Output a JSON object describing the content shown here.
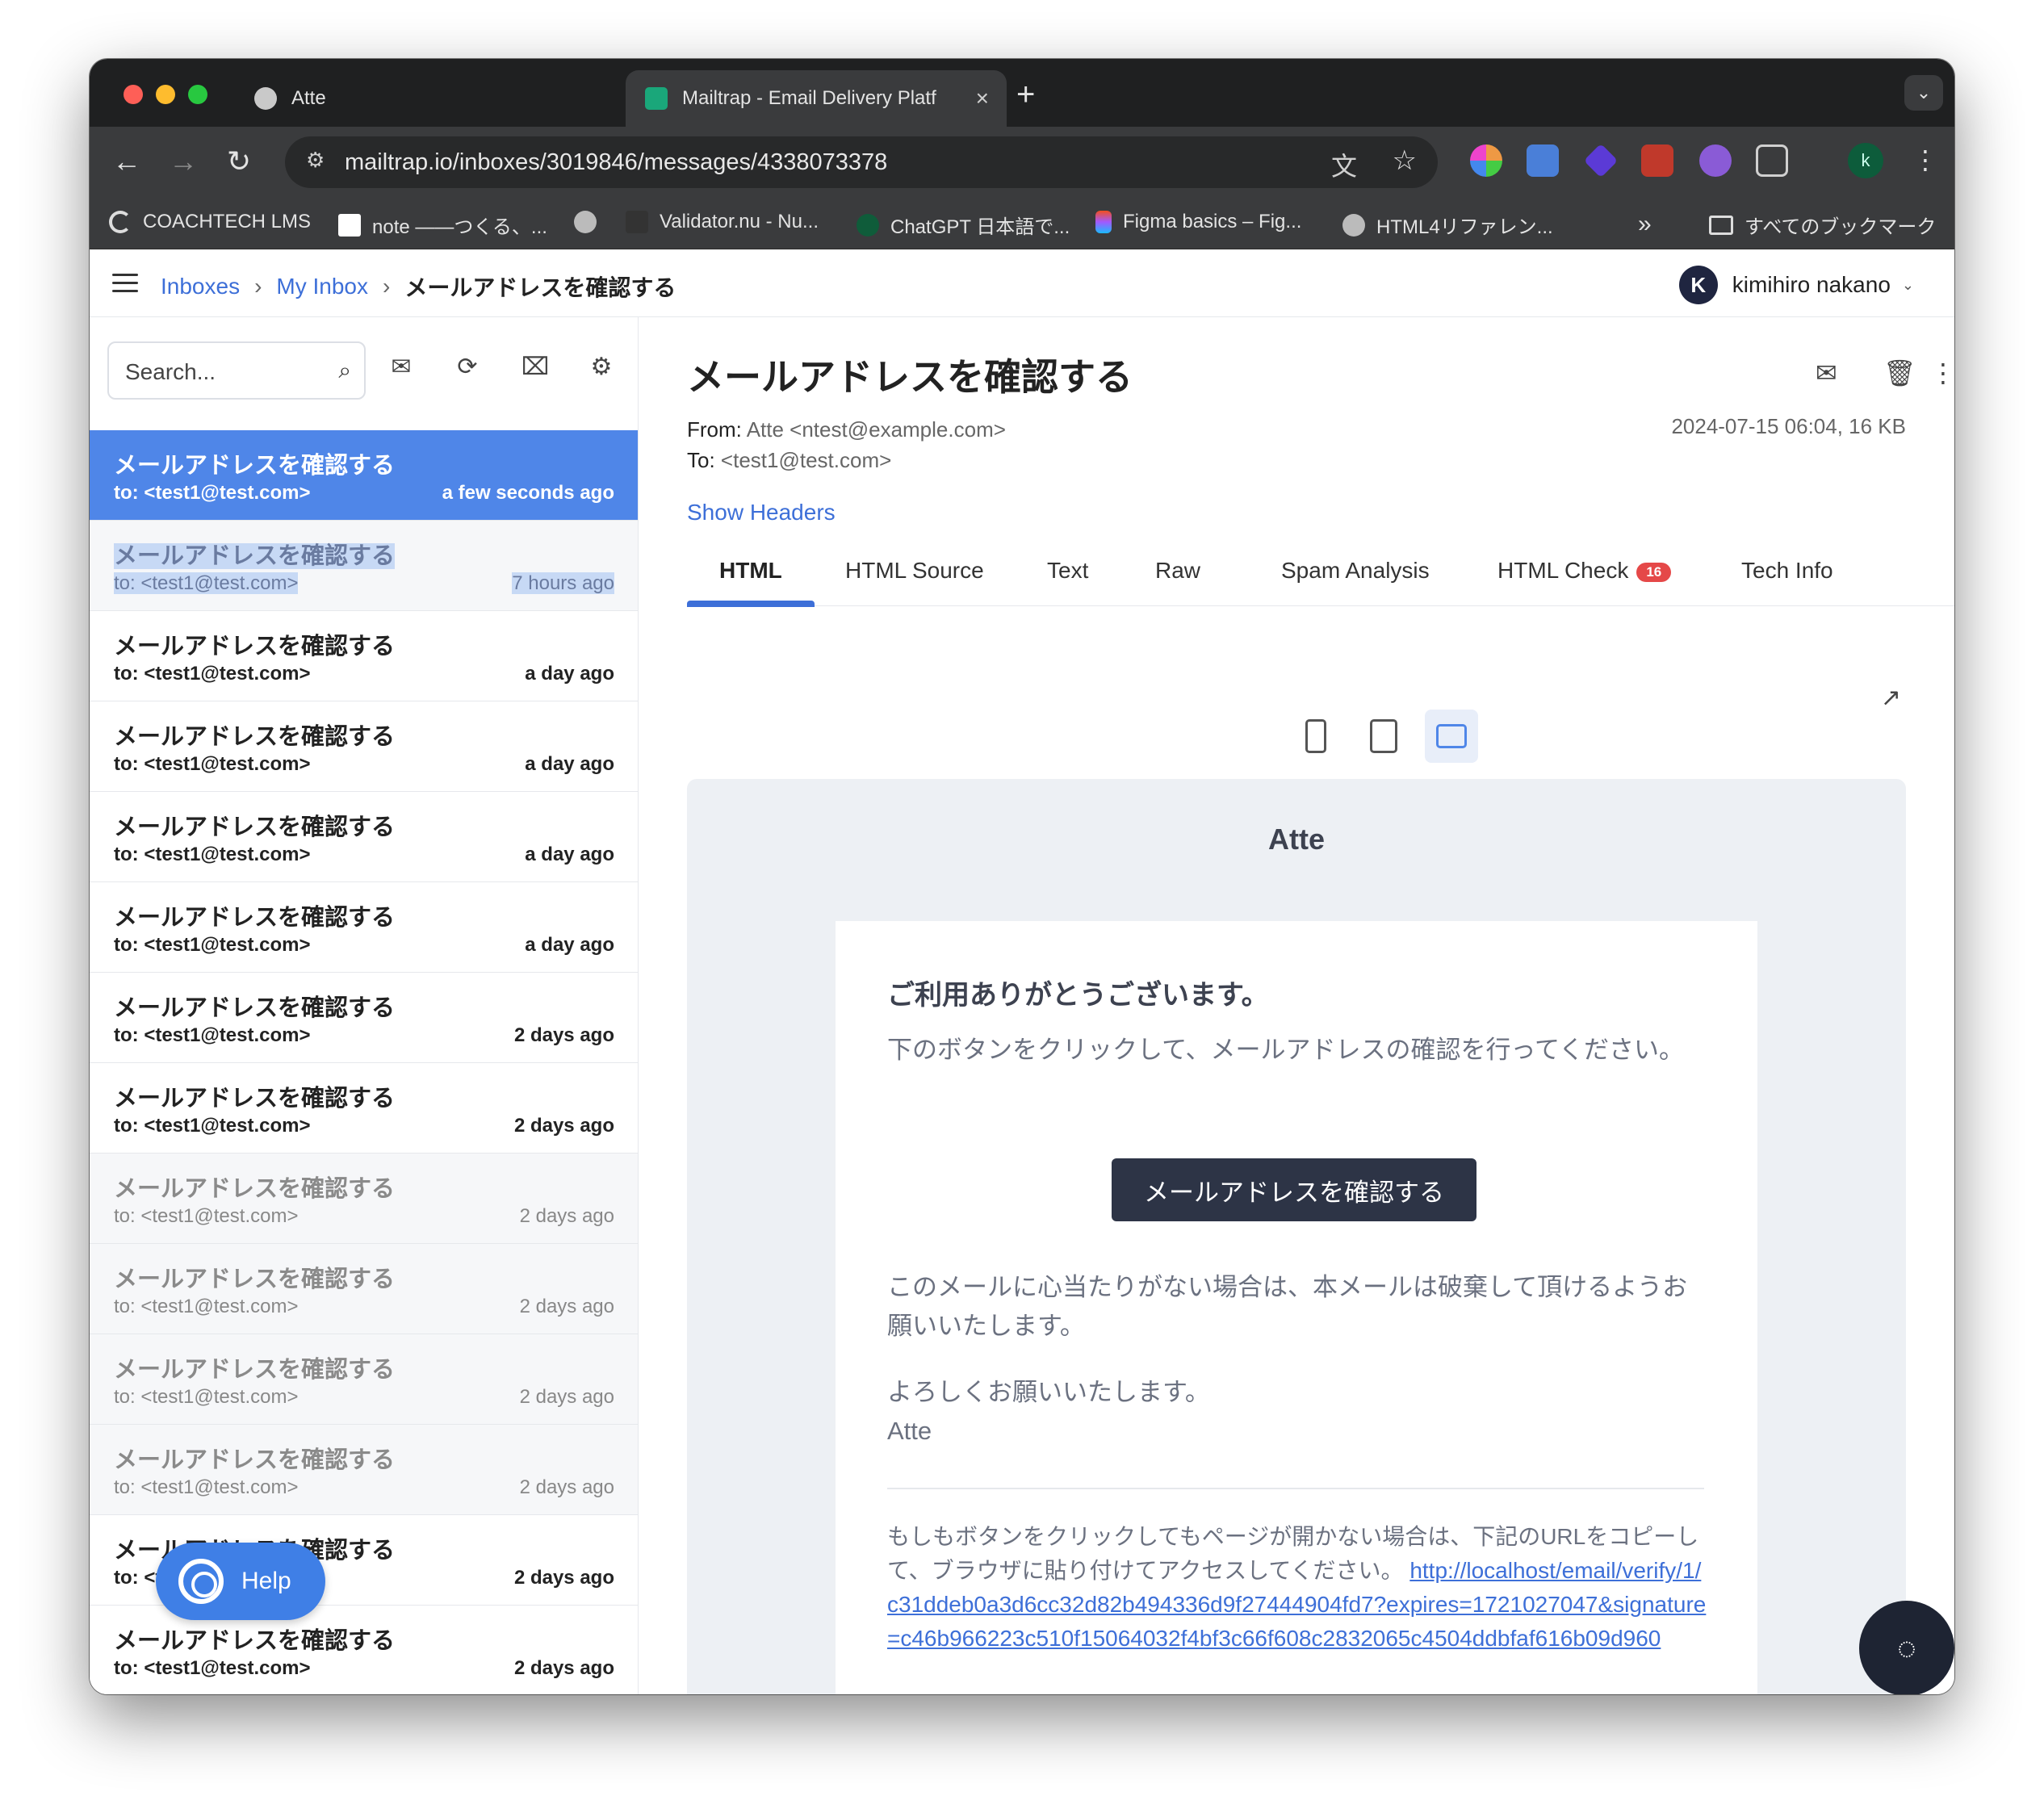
{
  "browser": {
    "tabs": [
      {
        "title": "Atte",
        "close": "×"
      },
      {
        "title": "Mailtrap - Email Delivery Platf",
        "close": "×"
      }
    ],
    "new_tab": "+",
    "url": "mailtrap.io/inboxes/3019846/messages/4338073378",
    "profile_initial": "k",
    "bookmarks": [
      "COACHTECH LMS",
      "note ——つくる、...",
      "",
      "Validator.nu - Nu...",
      "ChatGPT 日本語で...",
      "Figma basics – Fig...",
      "HTML4リファレン..."
    ],
    "bookmarks_overflow": "»",
    "all_bookmarks": "すべてのブックマーク"
  },
  "header": {
    "breadcrumbs": [
      "Inboxes",
      "My Inbox",
      "メールアドレスを確認する"
    ],
    "separator": "›",
    "user_initial": "K",
    "user_name": "kimihiro nakano"
  },
  "sidebar": {
    "search_placeholder": "Search...",
    "messages": [
      {
        "subject": "メールアドレスを確認する",
        "to": "to: <test1@test.com>",
        "time": "a few seconds ago"
      },
      {
        "subject": "メールアドレスを確認する",
        "to": "to: <test1@test.com>",
        "time": "7 hours ago"
      },
      {
        "subject": "メールアドレスを確認する",
        "to": "to: <test1@test.com>",
        "time": "a day ago"
      },
      {
        "subject": "メールアドレスを確認する",
        "to": "to: <test1@test.com>",
        "time": "a day ago"
      },
      {
        "subject": "メールアドレスを確認する",
        "to": "to: <test1@test.com>",
        "time": "a day ago"
      },
      {
        "subject": "メールアドレスを確認する",
        "to": "to: <test1@test.com>",
        "time": "a day ago"
      },
      {
        "subject": "メールアドレスを確認する",
        "to": "to: <test1@test.com>",
        "time": "2 days ago"
      },
      {
        "subject": "メールアドレスを確認する",
        "to": "to: <test1@test.com>",
        "time": "2 days ago"
      },
      {
        "subject": "メールアドレスを確認する",
        "to": "to: <test1@test.com>",
        "time": "2 days ago"
      },
      {
        "subject": "メールアドレスを確認する",
        "to": "to: <test1@test.com>",
        "time": "2 days ago"
      },
      {
        "subject": "メールアドレスを確認する",
        "to": "to: <test1@test.com>",
        "time": "2 days ago"
      },
      {
        "subject": "メールアドレスを確認する",
        "to": "to: <test1@test.com>",
        "time": "2 days ago"
      },
      {
        "subject": "メールアドレスを確認する",
        "to": "to: <test1@test.com>",
        "time": "2 days ago"
      },
      {
        "subject": "メールアドレスを確認する",
        "to": "to: <test1@test.com>",
        "time": "2 days ago"
      }
    ],
    "help_label": "Help"
  },
  "message": {
    "title": "メールアドレスを確認する",
    "from_label": "From:",
    "from_value": "Atte <ntest@example.com>",
    "to_label": "To:",
    "to_value": "<test1@test.com>",
    "meta": "2024-07-15 06:04, 16 KB",
    "show_headers": "Show Headers",
    "tabs": [
      "HTML",
      "HTML Source",
      "Text",
      "Raw",
      "Spam Analysis",
      "HTML Check",
      "Tech Info"
    ],
    "html_check_badge": "16"
  },
  "email": {
    "app_name": "Atte",
    "greeting": "ご利用ありがとうございます。",
    "instruction": "下のボタンをクリックして、メールアドレスの確認を行ってください。",
    "button": "メールアドレスを確認する",
    "ignore_note": "このメールに心当たりがない場合は、本メールは破棄して頂けるようお願いいたします。",
    "regards": "よろしくお願いいたします。",
    "signature": "Atte",
    "fallback_text": "もしもボタンをクリックしてもページが開かない場合は、下記のURLをコピーして、ブラウザに貼り付けてアクセスしてください。",
    "fallback_url": "http://localhost/email/verify/1/c31ddeb0a3d6cc32d82b494336d9f27444904fd7?expires=1721027047&signature=c46b966223c510f15064032f4bf3c66f608c2832065c4504ddbfaf616b09d960"
  },
  "colors": {
    "accent": "#3d6fd8",
    "active_row": "#4f86e8",
    "email_button": "#2d3446",
    "badge": "#e54848"
  }
}
